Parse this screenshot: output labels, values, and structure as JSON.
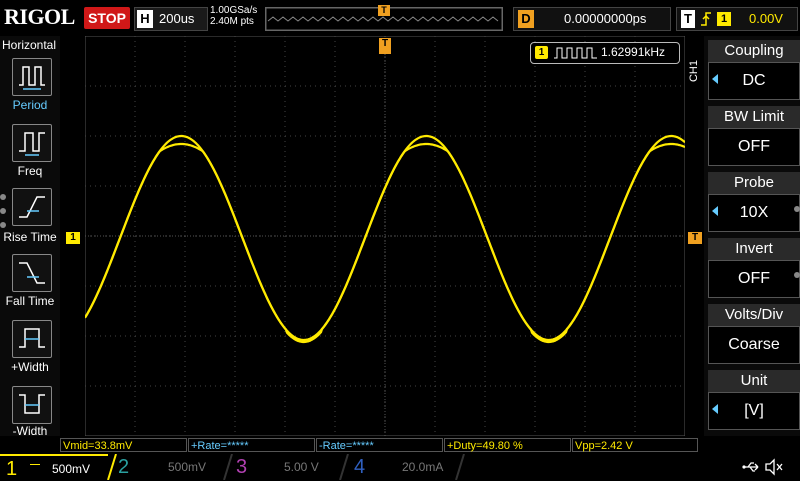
{
  "header": {
    "logo": "RIGOL",
    "run_state": "STOP",
    "timebase_letter": "H",
    "timebase": "200us",
    "sample_rate": "1.00GSa/s",
    "mem_depth": "2.40M pts",
    "trigger_pos_marker": "T",
    "delay_letter": "D",
    "delay": "0.00000000ps",
    "trigger_letter": "T",
    "trigger_slope": "f",
    "trigger_channel": "1",
    "trigger_level": "0.00V"
  },
  "left_menu": {
    "title": "Horizontal",
    "items": [
      {
        "label": "Period",
        "icon": "period-icon"
      },
      {
        "label": "Freq",
        "icon": "freq-icon"
      },
      {
        "label": "Rise Time",
        "icon": "rise-time-icon"
      },
      {
        "label": "Fall Time",
        "icon": "fall-time-icon"
      },
      {
        "label": "+Width",
        "icon": "pos-width-icon"
      },
      {
        "label": "-Width",
        "icon": "neg-width-icon"
      }
    ]
  },
  "display": {
    "freq_channel": "1",
    "frequency": "1.62991kHz",
    "ch_marker": "1",
    "trig_marker": "T"
  },
  "right_menu": {
    "channel_tag": "CH1",
    "items": [
      {
        "title": "Coupling",
        "value": "DC",
        "arrow": true
      },
      {
        "title": "BW Limit",
        "value": "OFF",
        "arrow": false
      },
      {
        "title": "Probe",
        "value": "10X",
        "arrow": true
      },
      {
        "title": "Invert",
        "value": "OFF",
        "arrow": false
      },
      {
        "title": "Volts/Div",
        "value": "Coarse",
        "arrow": false
      },
      {
        "title": "Unit",
        "value": "[V]",
        "arrow": true
      }
    ]
  },
  "measurements": {
    "vmid": "Vmid=33.8mV",
    "pos_rate": "+Rate=*****",
    "neg_rate": "-Rate=*****",
    "duty": "+Duty=49.80 %",
    "vpp": "Vpp=2.42 V"
  },
  "channels": [
    {
      "num": "1",
      "scale": "500mV",
      "color": "#ffea00",
      "active": true
    },
    {
      "num": "2",
      "scale": "500mV",
      "color": "#2aa0a0",
      "active": false
    },
    {
      "num": "3",
      "scale": "5.00 V",
      "color": "#b040b0",
      "active": false
    },
    {
      "num": "4",
      "scale": "20.0mA",
      "color": "#3060c0",
      "active": false
    }
  ],
  "colors": {
    "ch1": "#ffea00",
    "accent": "#66ccff",
    "stop": "#d01818",
    "trigger": "#f0a020"
  }
}
